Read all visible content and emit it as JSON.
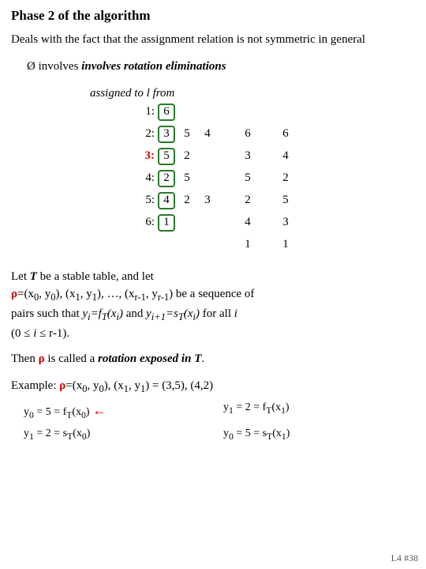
{
  "title": "Phase 2 of the algorithm",
  "intro": "Deals with the fact that the assignment relation is not symmetric in general",
  "bullet": "involves rotation eliminations",
  "assigned_label": "assigned to l from",
  "rows": [
    {
      "label": "1:",
      "boxed": [
        "6"
      ],
      "extra": []
    },
    {
      "label": "2:",
      "boxed": [
        "3"
      ],
      "extra": [
        "5",
        "4"
      ]
    },
    {
      "label": "3:",
      "boxed": [
        "5"
      ],
      "extra": [
        "2"
      ]
    },
    {
      "label": "4:",
      "boxed": [
        "2"
      ],
      "extra": [
        "5"
      ]
    },
    {
      "label": "5:",
      "boxed": [
        "4"
      ],
      "extra": [
        "2",
        "3"
      ]
    },
    {
      "label": "6:",
      "boxed": [
        "1"
      ],
      "extra": []
    }
  ],
  "right_col1": [
    "6",
    "3",
    "5",
    "2",
    "4",
    "1"
  ],
  "right_col2": [
    "6",
    "4",
    "2",
    "5",
    "3",
    "1"
  ],
  "stable_table_text": "Let T be a stable table, and let",
  "rho_seq": "ρ=(x₀, y₀), (x₁, y₁), …, (xᵣ₋₁, yᵣ₋₁)",
  "seq_suffix": " be a sequence of pairs such that",
  "yi_condition": "yᵢ=fT(xᵢ)",
  "and_text": " and ",
  "yi1_condition": "yᵢ₊₁=sT(xᵢ)",
  "for_all": " for all i",
  "range": "(0 ≤ i ≤ r-1).",
  "then_text": "Then",
  "rho_called": "ρ is called a",
  "rotation_exposed": "rotation exposed in T",
  "then_period": ".",
  "example_label": "Example: ρ=(x₀, y₀), (x₁, y₁) = (3,5), (4,2)",
  "sub1": "y₀ = 5 = fT(x₀)",
  "arrow1": "←",
  "sub2": "y₁ = 2 = fT(x₁)",
  "sub3": "y₁ = 2 = sT(x₀)",
  "sub4": "y₀ = 5 = sT(x₁)",
  "slide": "L4 #38"
}
